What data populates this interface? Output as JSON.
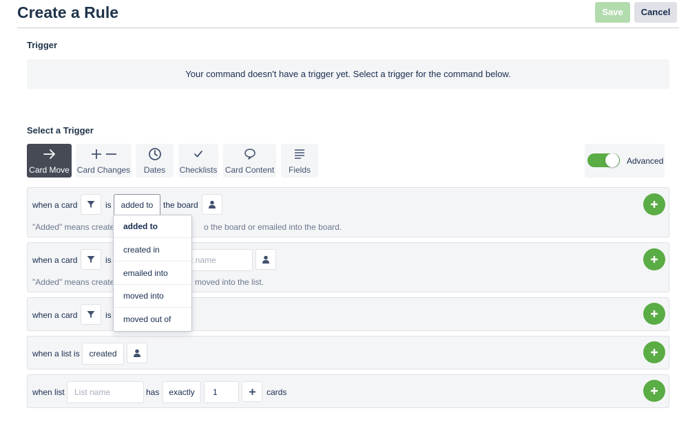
{
  "header": {
    "title": "Create a Rule",
    "save_label": "Save",
    "cancel_label": "Cancel"
  },
  "trigger_section": {
    "title": "Trigger",
    "message": "Your command doesn't have a trigger yet. Select a trigger for the command below."
  },
  "select_trigger": {
    "title": "Select a Trigger",
    "tabs": [
      {
        "label": "Card Move",
        "icon": "arrow-right-icon",
        "active": true
      },
      {
        "label": "Card Changes",
        "icon": "plus-minus-icon",
        "active": false
      },
      {
        "label": "Dates",
        "icon": "clock-icon",
        "active": false
      },
      {
        "label": "Checklists",
        "icon": "check-icon",
        "active": false
      },
      {
        "label": "Card Content",
        "icon": "comment-icon",
        "active": false
      },
      {
        "label": "Fields",
        "icon": "lines-icon",
        "active": false
      }
    ],
    "advanced": {
      "label": "Advanced",
      "enabled": true
    }
  },
  "rules": {
    "row1": {
      "when": "when a card",
      "is": "is",
      "action": "added to",
      "target": "the board",
      "hint_a": "\"Added\" means create",
      "hint_b": "o the board or emailed into the board."
    },
    "row2": {
      "when": "when a card",
      "is": "is",
      "list_placeholder": "t name",
      "hint_a": "\"Added\" means create",
      "hint_b": "moved into the list."
    },
    "row3": {
      "when": "when a card",
      "is": "is"
    },
    "row4": {
      "when": "when a list is",
      "action": "created"
    },
    "row5": {
      "when": "when list",
      "list_placeholder": "List name",
      "has": "has",
      "comparator": "exactly",
      "count": "1",
      "unit": "cards"
    }
  },
  "dropdown": {
    "options": [
      "added to",
      "created in",
      "emailed into",
      "moved into",
      "moved out of"
    ],
    "selected": "added to"
  },
  "colors": {
    "accent_green": "#5aac44",
    "active_tab": "#454a55",
    "save_disabled": "#b3dcae"
  }
}
